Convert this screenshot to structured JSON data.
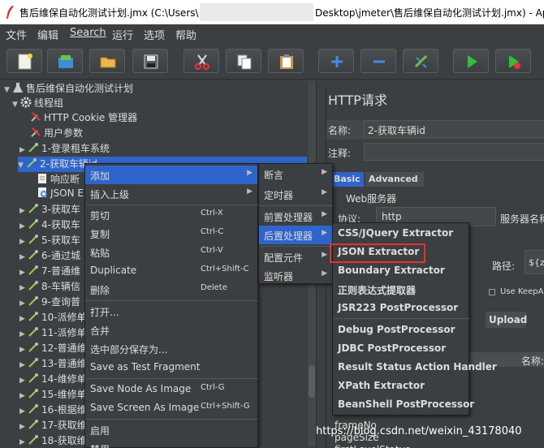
{
  "titlebar": {
    "title_left": "售后维保自动化测试计划.jmx (C:\\Users\\",
    "title_right": "Desktop\\jmeter\\售后维保自动化测试计划.jmx) - Ap"
  },
  "menubar": {
    "items": [
      "文件",
      "编辑",
      "Search",
      "运行",
      "选项",
      "帮助"
    ]
  },
  "toolbar": {
    "buttons": [
      "new-icon",
      "templates-icon",
      "open-icon",
      "save-icon",
      "cut-icon",
      "copy-icon",
      "paste-icon",
      "expand-icon",
      "collapse-icon",
      "toggle-icon",
      "start-icon",
      "start-no-pause-icon"
    ]
  },
  "tree": {
    "root": "售后维保自动化测试计划",
    "thread_group": "线程组",
    "cookie_manager": "HTTP Cookie 管理器",
    "user_params": "用户参数",
    "items": [
      "1-登录租车系统",
      "2-获取车辆id",
      "响应断",
      "JSON E",
      "3-获取车",
      "4-获取车",
      "5-获取车",
      "6-通过城",
      "7-普通维",
      "8-车辆信",
      "9-查询普",
      "10-派修单",
      "11-派修单",
      "12-普通维",
      "13-普通维",
      "14-维修单",
      "15-维修单",
      "16-根据维",
      "17-获取维",
      "18-获取维"
    ]
  },
  "context_menu": {
    "items": [
      {
        "label": "添加",
        "shortcut": "",
        "sub": true
      },
      {
        "label": "插入上级",
        "shortcut": "",
        "sub": true
      },
      {
        "label": "剪切",
        "shortcut": "Ctrl-X"
      },
      {
        "label": "复制",
        "shortcut": "Ctrl-C"
      },
      {
        "label": "粘贴",
        "shortcut": "Ctrl-V"
      },
      {
        "label": "Duplicate",
        "shortcut": "Ctrl+Shift-C"
      },
      {
        "label": "删除",
        "shortcut": "Delete"
      },
      {
        "label": "打开..."
      },
      {
        "label": "合并"
      },
      {
        "label": "选中部分保存为..."
      },
      {
        "label": "Save as Test Fragment"
      },
      {
        "label": "Save Node As Image",
        "shortcut": "Ctrl-G"
      },
      {
        "label": "Save Screen As Image",
        "shortcut": "Ctrl+Shift-G"
      },
      {
        "label": "启用"
      },
      {
        "label": "禁用"
      }
    ]
  },
  "add_submenu": {
    "items": [
      "断言",
      "定时器",
      "前置处理器",
      "后置处理器",
      "配置元件",
      "监听器"
    ]
  },
  "post_processor_submenu": {
    "items": [
      "CSS/JQuery Extractor",
      "JSON Extractor",
      "Boundary Extractor",
      "正则表达式提取器",
      "JSR223 PostProcessor",
      "Debug PostProcessor",
      "JDBC PostProcessor",
      "Result Status Action Handler",
      "XPath Extractor",
      "BeanShell PostProcessor"
    ]
  },
  "http_panel": {
    "title": "HTTP请求",
    "name_label": "名称:",
    "name_value": "2-获取车辆id",
    "comment_label": "注释:",
    "tab_basic": "Basic",
    "tab_advanced": "Advanced",
    "web_server": "Web服务器",
    "protocol_label": "协议:",
    "protocol_value": "http",
    "server_label": "服务器名称",
    "path_label": "路径:",
    "path_value": "${zue",
    "keepalive": "Use KeepAliv",
    "upload_tab": "Upload",
    "name_col": "名称:",
    "params": [
      "frameNo",
      "pageSize",
      "firstLevelStatus"
    ]
  },
  "watermark": "https://blog.csdn.net/weixin_43178040",
  "colors": {
    "background": "#3c3f41",
    "selection": "#2f65ca",
    "highlight_box": "#e0352b"
  }
}
